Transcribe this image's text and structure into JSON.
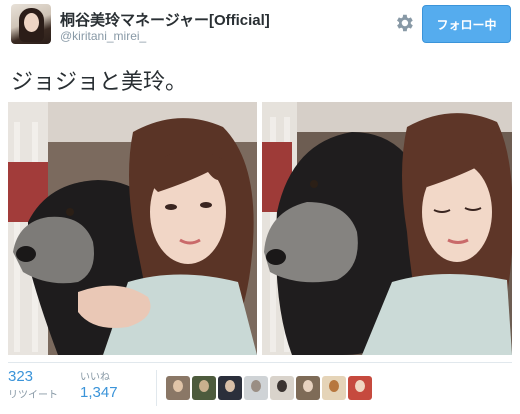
{
  "header": {
    "display_name": "桐谷美玲マネージャー[Official]",
    "handle": "@kiritani_mirei_",
    "follow_label": "フォロー中",
    "settings_icon": "gear-icon",
    "avatar_icon": "profile-avatar"
  },
  "tweet": {
    "text": "ジョジョと美玲。"
  },
  "stats": {
    "retweets_count": "323",
    "retweets_label": "リツイート",
    "likes_label": "いいね",
    "likes_count": "1,347"
  },
  "likers": [
    {
      "icon": "liker-avatar",
      "bg": "#8a7766",
      "face": "#e0c4a8"
    },
    {
      "icon": "liker-avatar",
      "bg": "#4d5b3d",
      "face": "#c9b08e"
    },
    {
      "icon": "liker-avatar",
      "bg": "#2b2f3b",
      "face": "#d8bfa8"
    },
    {
      "icon": "liker-avatar",
      "bg": "#cfd3d6",
      "face": "#9a8e84"
    },
    {
      "icon": "liker-avatar",
      "bg": "#d9d3cb",
      "face": "#3a3330"
    },
    {
      "icon": "liker-avatar",
      "bg": "#7e6b57",
      "face": "#e7d2bf"
    },
    {
      "icon": "liker-avatar",
      "bg": "#e5d4b8",
      "face": "#b7773e"
    },
    {
      "icon": "liker-avatar",
      "bg": "#c64a3e",
      "face": "#f0d7c2"
    }
  ],
  "colors": {
    "accent": "#55acee",
    "link": "#3b94d9",
    "muted": "#8899a6"
  }
}
